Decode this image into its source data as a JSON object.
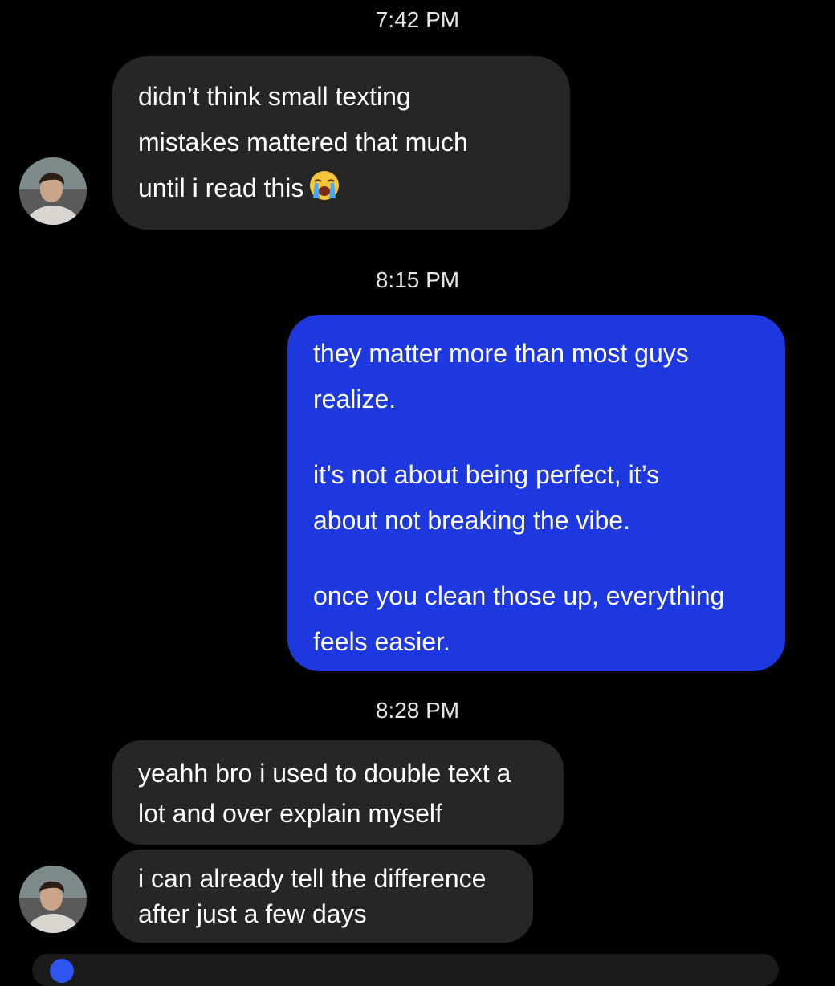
{
  "thread": {
    "messages_group_1": {
      "timestamp": "7:42 PM",
      "incoming_1": {
        "lines": [
          "didn’t think small texting",
          "mistakes mattered that much",
          "until i read this"
        ],
        "emoji": "loudly-crying-face-emoji"
      }
    },
    "messages_group_2": {
      "timestamp": "8:15 PM",
      "outgoing_1": {
        "paragraphs": [
          [
            "they matter more than most guys",
            "realize."
          ],
          [
            "it’s not about being perfect, it’s",
            "about not breaking the vibe."
          ],
          [
            "once you clean those up, everything",
            "feels easier."
          ]
        ]
      }
    },
    "messages_group_3": {
      "timestamp": "8:28 PM",
      "incoming_2": {
        "lines": [
          "yeahh bro i used to double text a",
          "lot and over explain myself"
        ]
      },
      "incoming_3": {
        "lines": [
          "i can already tell the difference",
          "after just a few days"
        ]
      }
    }
  },
  "colors": {
    "background": "#000000",
    "incoming_bubble": "#262626",
    "outgoing_bubble": "#1e38e0",
    "text": "#ffffff"
  },
  "icons": {
    "avatar": "user-avatar-photo",
    "emoji": "loudly-crying-face-emoji"
  }
}
